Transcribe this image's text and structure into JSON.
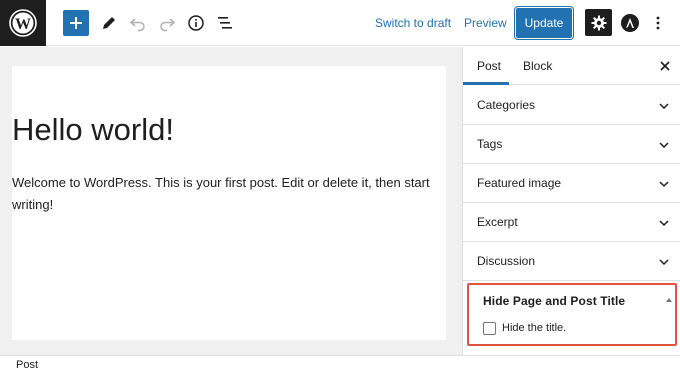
{
  "toolbar": {
    "logo_icon": "wordpress-logo",
    "add_icon": "plus-icon",
    "tools_icon": "pencil-icon",
    "undo_icon": "undo-icon",
    "redo_icon": "redo-icon",
    "info_icon": "info-icon",
    "outline_icon": "list-view-icon",
    "switch_to_draft": "Switch to draft",
    "preview": "Preview",
    "update": "Update",
    "settings_icon": "gear-icon",
    "astra_icon": "astra-logo",
    "more_icon": "vertical-ellipsis-icon"
  },
  "editor": {
    "title": "Hello world!",
    "body": "Welcome to WordPress. This is your first post. Edit or delete it, then start writing!"
  },
  "sidebar": {
    "tabs": [
      {
        "label": "Post",
        "active": true
      },
      {
        "label": "Block",
        "active": false
      }
    ],
    "close_icon": "close-icon",
    "panels": [
      {
        "label": "Categories"
      },
      {
        "label": "Tags"
      },
      {
        "label": "Featured image"
      },
      {
        "label": "Excerpt"
      },
      {
        "label": "Discussion"
      }
    ],
    "hide_title_panel": {
      "title": "Hide Page and Post Title",
      "checkbox_label": "Hide the title.",
      "checked": false,
      "highlight_color": "#e0533d"
    }
  },
  "footer": {
    "breadcrumb": "Post"
  },
  "colors": {
    "accent": "#2271b1",
    "dark": "#1e1e1e"
  }
}
